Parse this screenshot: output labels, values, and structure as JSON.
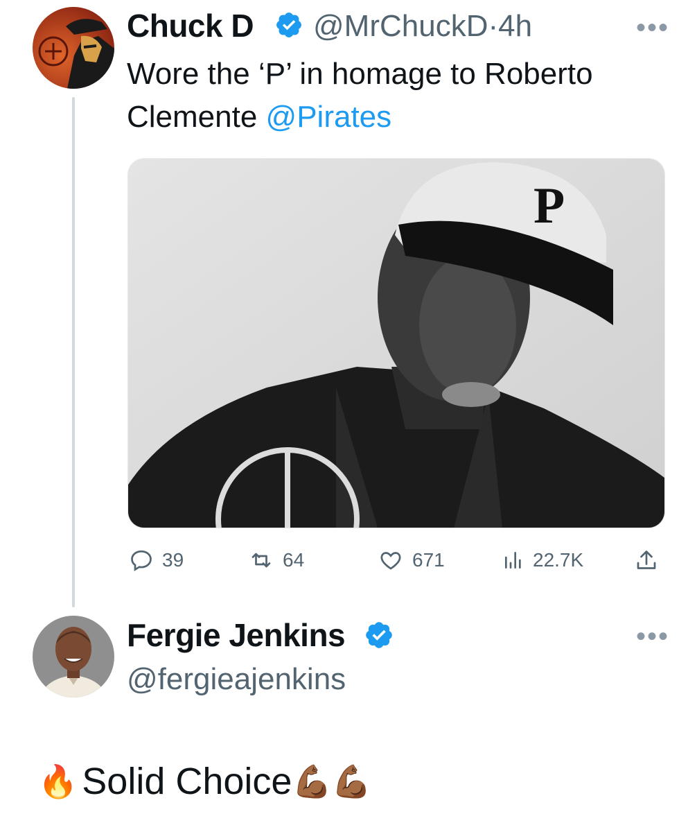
{
  "tweet": {
    "author_name": "Chuck D",
    "handle_time": "@MrChuckD·4h",
    "text_line1": "Wore the ‘P’ in homage to Roberto",
    "text_line2": "Clemente ",
    "mention": "@Pirates",
    "more_label": "•••",
    "stats": {
      "replies": "39",
      "retweets": "64",
      "likes": "671",
      "views": "22.7K"
    }
  },
  "reply": {
    "author_name": "Fergie Jenkins",
    "handle": "@fergieajenkins",
    "more_label": "•••",
    "text": "Solid Choice",
    "emoji_fire": "🔥",
    "emoji_flex": "💪🏾💪🏾"
  },
  "colors": {
    "accent": "#1d9bf0",
    "text": "#0f1419",
    "secondary": "#536471"
  },
  "icons": [
    "verified-badge-icon",
    "more-icon",
    "reply-icon",
    "retweet-icon",
    "like-icon",
    "views-icon",
    "share-icon",
    "fire-emoji",
    "flexed-bicep-emoji"
  ]
}
